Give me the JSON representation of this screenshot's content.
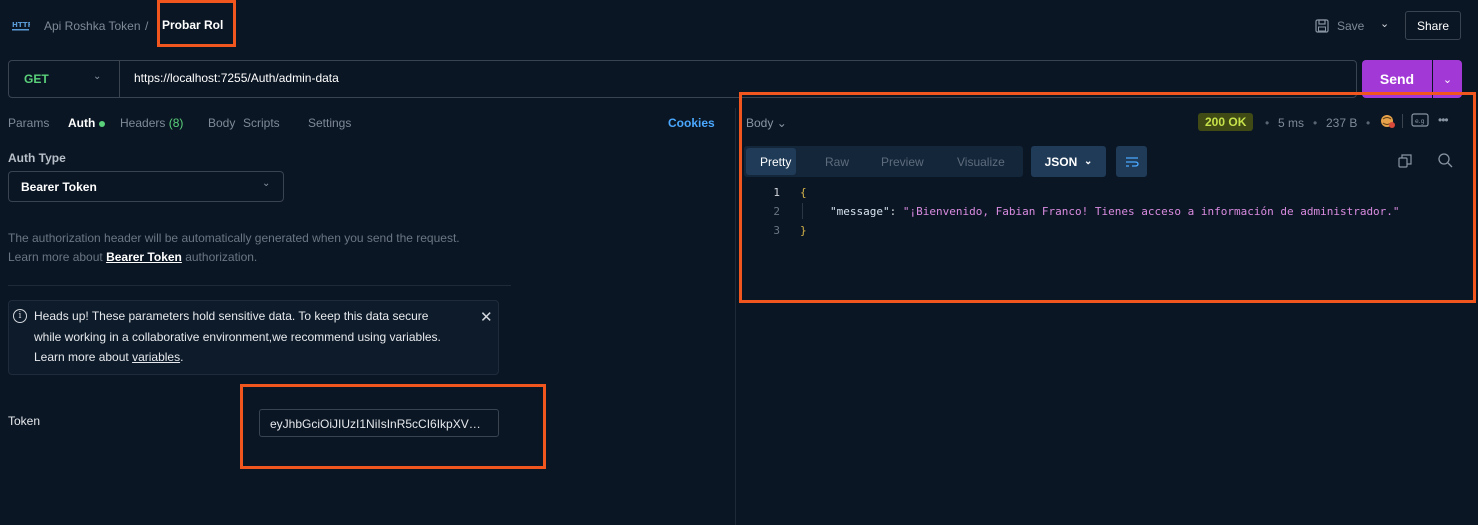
{
  "header": {
    "protocol_icon": "http-icon",
    "collection": "Api Roshka Token",
    "separator": "/",
    "request_name": "Probar Rol",
    "save_label": "Save",
    "share_label": "Share"
  },
  "request": {
    "method": "GET",
    "url": "https://localhost:7255/Auth/admin-data",
    "send_label": "Send"
  },
  "tabs": {
    "params": "Params",
    "auth": "Auth",
    "headers": "Headers",
    "headers_count": "(8)",
    "body": "Body",
    "scripts": "Scripts",
    "settings": "Settings",
    "cookies": "Cookies"
  },
  "auth": {
    "type_label": "Auth Type",
    "type_value": "Bearer Token",
    "info_line1": "The authorization header will be automatically generated when you send the request.",
    "info_line2_pre": "Learn more about ",
    "info_line2_link": "Bearer Token",
    "info_line2_post": " authorization.",
    "warning_line1": "Heads up! These parameters hold sensitive data. To keep this data secure",
    "warning_line2": "while working in a collaborative environment,we recommend using variables.",
    "warning_line3_pre": "Learn more about ",
    "warning_line3_link": "variables",
    "warning_line3_post": ".",
    "token_label": "Token",
    "token_value": "eyJhbGciOiJIUzI1NiIsInR5cCI6IkpXVCJ9..."
  },
  "response": {
    "body_label": "Body",
    "status": "200 OK",
    "time": "5 ms",
    "size": "237 B",
    "view_tabs": [
      "Pretty",
      "Raw",
      "Preview",
      "Visualize"
    ],
    "format": "JSON",
    "line_numbers": [
      "1",
      "2",
      "3"
    ],
    "open_brace": "{",
    "close_brace": "}",
    "json_key": "\"message\"",
    "json_colon": ": ",
    "json_value": "\"¡Bienvenido, Fabian Franco! Tienes acceso a información de administrador.\""
  },
  "colors": {
    "background": "#0b1624",
    "accent": "#a239d6",
    "method": "#5ad17a",
    "highlight": "#f0561e",
    "status_bg": "#3f4a14",
    "status_text": "#c6e24a"
  }
}
